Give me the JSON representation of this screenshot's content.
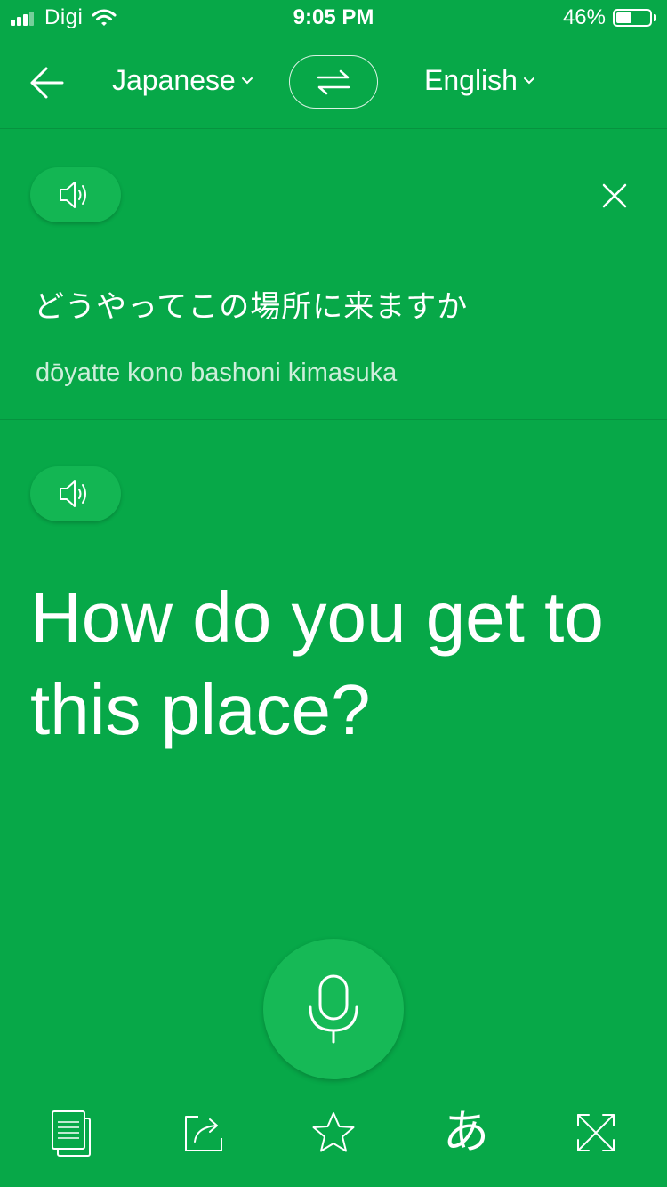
{
  "status_bar": {
    "carrier": "Digi",
    "time": "9:05 PM",
    "battery_percent": "46%",
    "battery_level": 0.46
  },
  "nav": {
    "back_icon": "arrow-left-icon",
    "source_language": "Japanese",
    "target_language": "English",
    "swap_icon": "swap-arrows-icon"
  },
  "source": {
    "text": "どうやってこの場所に来ますか",
    "romanization": "dōyatte kono bashoni kimasuka",
    "speak_icon": "speaker-icon",
    "clear_icon": "close-icon"
  },
  "target": {
    "text": "How do you get to this place?",
    "speak_icon": "speaker-icon"
  },
  "mic": {
    "icon": "microphone-icon"
  },
  "toolbar": {
    "items": [
      {
        "icon": "copy-icon"
      },
      {
        "icon": "share-icon"
      },
      {
        "icon": "star-icon"
      },
      {
        "icon": "kana-icon",
        "label": "あ"
      },
      {
        "icon": "expand-icon"
      }
    ]
  },
  "colors": {
    "background": "#07a848",
    "button": "#13b653",
    "text": "#ffffff"
  }
}
